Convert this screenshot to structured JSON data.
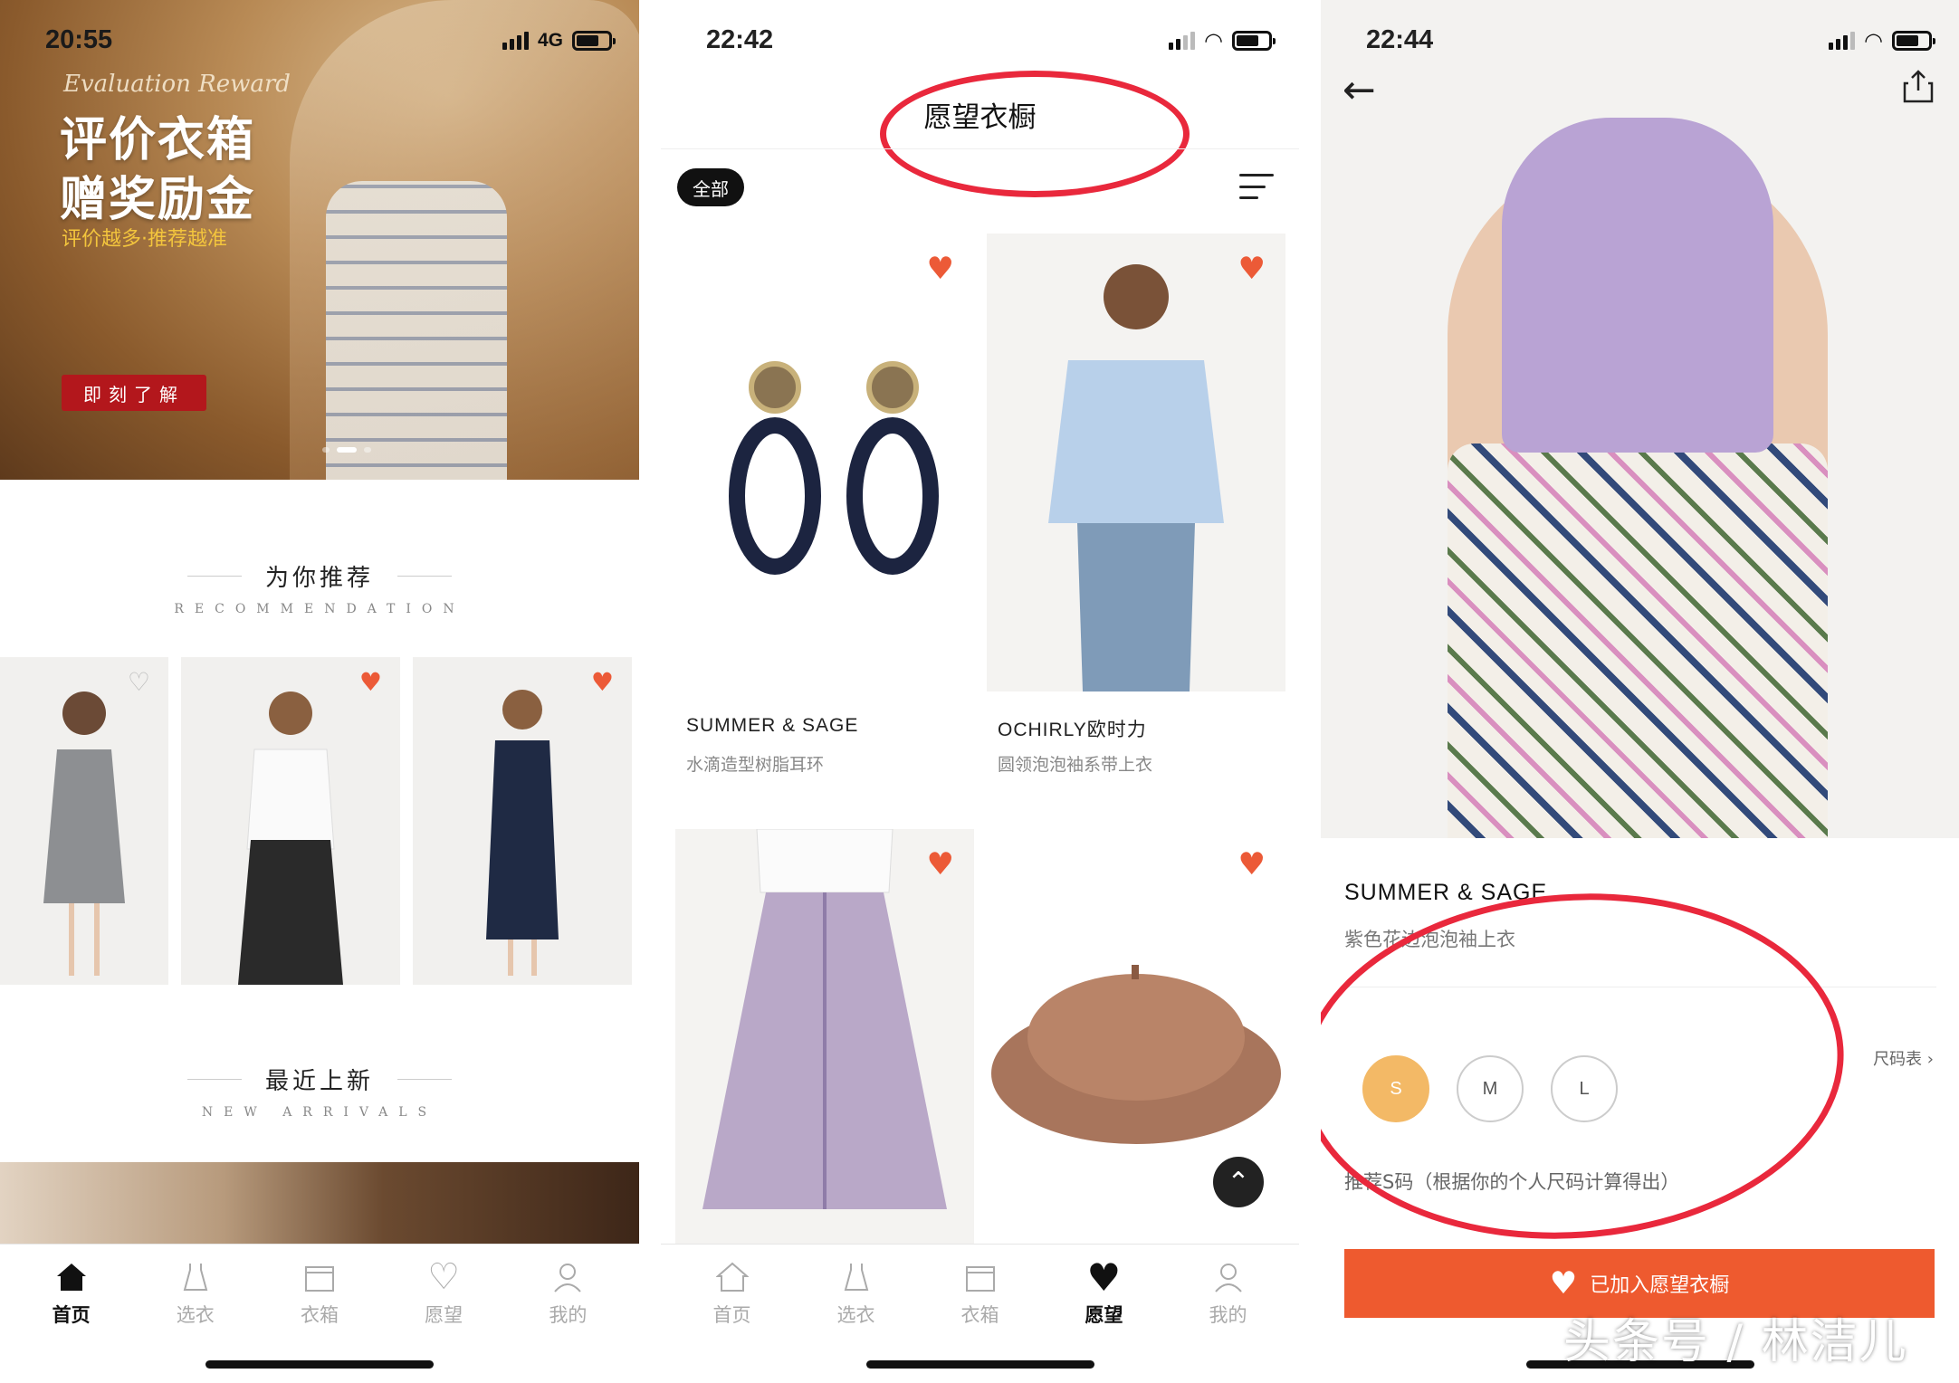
{
  "screen1": {
    "status": {
      "time": "20:55",
      "network": "4G"
    },
    "hero": {
      "script": "Evaluation Reward",
      "title1": "评价衣箱",
      "title2": "赠奖励金",
      "subtitle": "评价越多·推荐越准",
      "button": "即刻了解"
    },
    "recommend": {
      "title": "为你推荐",
      "subtitle": "RECOMMENDATION"
    },
    "arrivals": {
      "title": "最近上新",
      "subtitle": "NEW ARRIVALS"
    },
    "tabs": [
      "首页",
      "选衣",
      "衣箱",
      "愿望",
      "我的"
    ]
  },
  "screen2": {
    "status": {
      "time": "22:42"
    },
    "title": "愿望衣橱",
    "filter_all": "全部",
    "items": [
      {
        "brand": "SUMMER & SAGE",
        "name": "水滴造型树脂耳环"
      },
      {
        "brand": "OCHIRLY欧时力",
        "name": "圆领泡泡袖系带上衣"
      },
      {
        "brand": "",
        "name": ""
      },
      {
        "brand": "",
        "name": ""
      }
    ],
    "tabs": [
      "首页",
      "选衣",
      "衣箱",
      "愿望",
      "我的"
    ]
  },
  "screen3": {
    "status": {
      "time": "22:44"
    },
    "brand": "SUMMER & SAGE",
    "name": "紫色花边泡泡袖上衣",
    "size_chart": "尺码表",
    "sizes": [
      "S",
      "M",
      "L"
    ],
    "size_hint": "推荐S码（根据你的个人尺码计算得出）",
    "wish_button": "已加入愿望衣橱",
    "watermark": "头条号 / 林洁儿"
  },
  "colors": {
    "accent_orange": "#ee5a2f",
    "heart": "#ec5a37",
    "size_selected": "#f3b966",
    "hero_button": "#b3171c",
    "annotation_red": "#e9283c"
  }
}
